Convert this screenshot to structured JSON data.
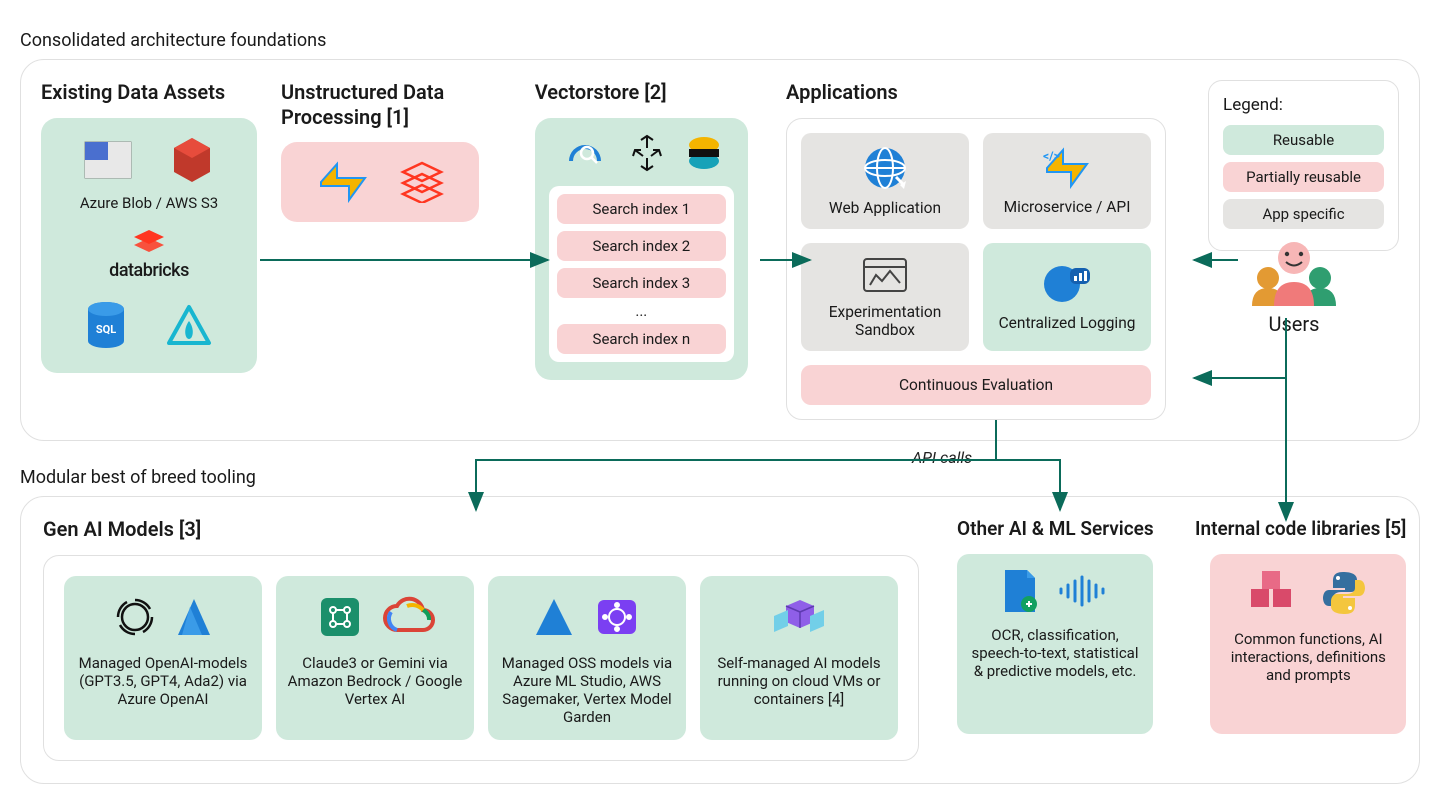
{
  "sections": {
    "top_title": "Consolidated architecture foundations",
    "bottom_title": "Modular best of breed tooling"
  },
  "data_assets": {
    "title": "Existing Data Assets",
    "storage_caption": "Azure Blob / AWS S3",
    "databricks_caption": "databricks"
  },
  "unstructured": {
    "title": "Unstructured Data Processing [1]"
  },
  "vectorstore": {
    "title": "Vectorstore [2]",
    "indexes": [
      "Search index 1",
      "Search index 2",
      "Search index 3",
      "...",
      "Search index n"
    ]
  },
  "applications": {
    "title": "Applications",
    "web_app": "Web Application",
    "microservice": "Microservice / API",
    "sandbox": "Experimentation Sandbox",
    "logging": "Centralized Logging",
    "evaluation": "Continuous Evaluation"
  },
  "legend": {
    "title": "Legend:",
    "reusable": "Reusable",
    "partial": "Partially reusable",
    "app_specific": "App specific"
  },
  "users_label": "Users",
  "api_calls_label": "API calls",
  "genai": {
    "title": "Gen AI Models [3]",
    "models": [
      "Managed OpenAI-models (GPT3.5, GPT4, Ada2) via Azure OpenAI",
      "Claude3 or Gemini via Amazon Bedrock / Google Vertex AI",
      "Managed OSS models via Azure ML Studio, AWS Sagemaker, Vertex Model Garden",
      "Self-managed AI models running on cloud VMs or containers [4]"
    ]
  },
  "other_services": {
    "title": "Other AI & ML Services",
    "desc": "OCR, classification, speech-to-text, statistical & predictive models, etc."
  },
  "libraries": {
    "title": "Internal code libraries [5]",
    "desc": "Common functions, AI interactions, definitions and prompts"
  },
  "colors": {
    "reusable": "#cfe9dc",
    "partial": "#f9d3d4",
    "app_specific": "#e5e4e2",
    "arrow": "#0b6b5a"
  }
}
